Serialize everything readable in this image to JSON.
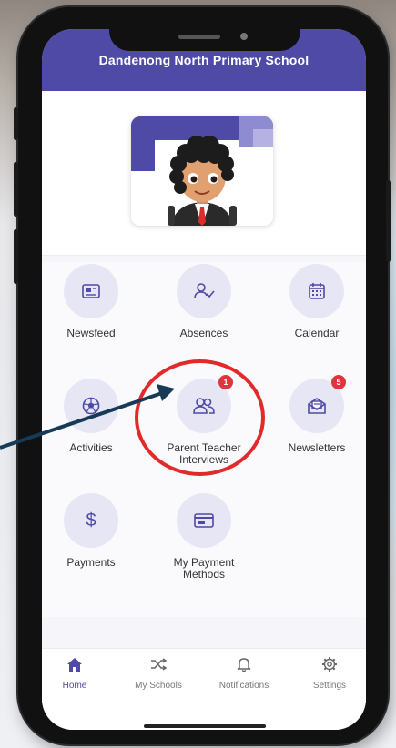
{
  "app": {
    "school_name": "Dandenong North Primary School"
  },
  "tiles": [
    {
      "label": "Newsfeed",
      "icon": "newsfeed-icon",
      "badge": null
    },
    {
      "label": "Absences",
      "icon": "absences-icon",
      "badge": null
    },
    {
      "label": "Calendar",
      "icon": "calendar-icon",
      "badge": null
    },
    {
      "label": "Activities",
      "icon": "activities-icon",
      "badge": null
    },
    {
      "label": "Parent Teacher Interviews",
      "icon": "people-icon",
      "badge": "1"
    },
    {
      "label": "Newsletters",
      "icon": "newsletter-icon",
      "badge": "5"
    },
    {
      "label": "Payments",
      "icon": "dollar-icon",
      "badge": null
    },
    {
      "label": "My Payment Methods",
      "icon": "card-icon",
      "badge": null
    }
  ],
  "nav": [
    {
      "label": "Home",
      "icon": "home-icon",
      "active": true
    },
    {
      "label": "My Schools",
      "icon": "shuffle-icon",
      "active": false
    },
    {
      "label": "Notifications",
      "icon": "bell-icon",
      "active": false
    },
    {
      "label": "Settings",
      "icon": "gear-icon",
      "active": false
    }
  ],
  "colors": {
    "primary": "#4f4aa6",
    "tile_bg": "#e7e6f5",
    "badge": "#e0343f",
    "annotation": "#e12a2a",
    "arrow": "#173a56"
  }
}
